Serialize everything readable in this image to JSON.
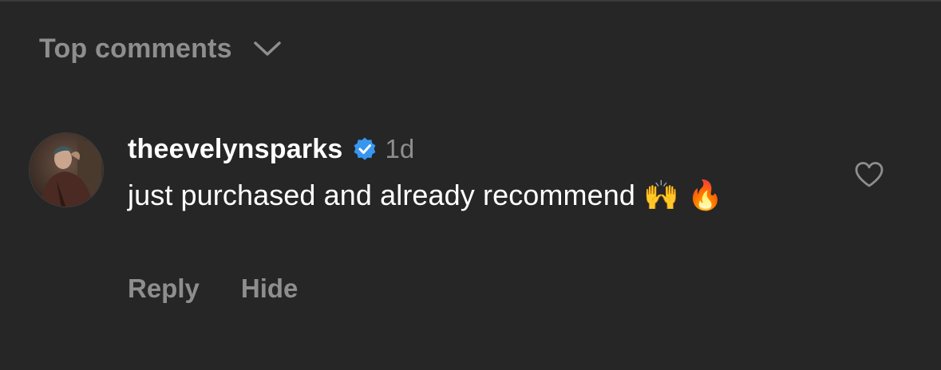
{
  "comments_sort": {
    "label": "Top comments",
    "icon": "chevron-down-icon"
  },
  "comment": {
    "username": "theevelynsparks",
    "verified": true,
    "verified_color": "#3797F0",
    "timestamp": "1d",
    "text": "just purchased and already recommend 🙌 🔥",
    "like_icon": "heart-outline-icon",
    "actions": {
      "reply": "Reply",
      "hide": "Hide"
    }
  },
  "colors": {
    "background": "#262626",
    "primary_text": "#FFFFFF",
    "secondary_text": "#8E8E8E"
  }
}
